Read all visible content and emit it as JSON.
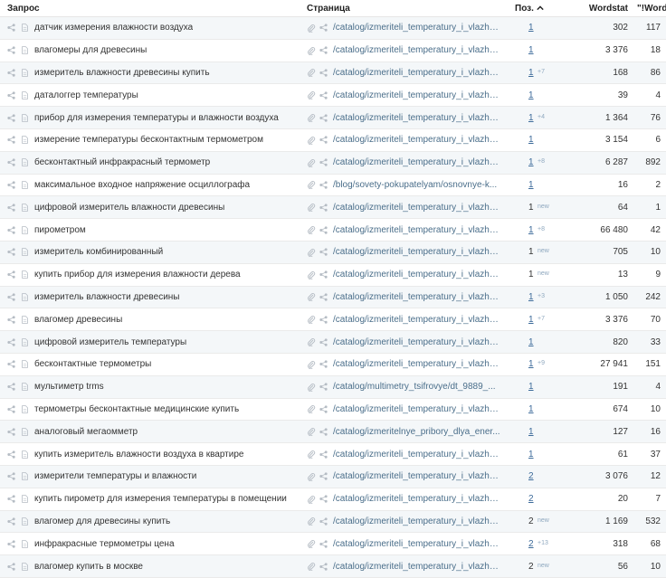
{
  "header": {
    "query": "Запрос",
    "page": "Страница",
    "pos": "Поз.",
    "wordstat": "Wordstat",
    "wordstat_exact": "\"!Wordstat\""
  },
  "rows": [
    {
      "query": "датчик измерения влажности воздуха",
      "url": "/catalog/izmeriteli_temperatury_i_vlazhn...",
      "pos": "1",
      "delta": "",
      "ws": "302",
      "wse": "117",
      "linked": true
    },
    {
      "query": "влагомеры для древесины",
      "url": "/catalog/izmeriteli_temperatury_i_vlazhn...",
      "pos": "1",
      "delta": "",
      "ws": "3 376",
      "wse": "18",
      "linked": true
    },
    {
      "query": "измеритель влажности древесины купить",
      "url": "/catalog/izmeriteli_temperatury_i_vlazhn...",
      "pos": "1",
      "delta": "+7",
      "ws": "168",
      "wse": "86",
      "linked": true
    },
    {
      "query": "даталоггер температуры",
      "url": "/catalog/izmeriteli_temperatury_i_vlazhn...",
      "pos": "1",
      "delta": "",
      "ws": "39",
      "wse": "4",
      "linked": true
    },
    {
      "query": "прибор для измерения температуры и влажности воздуха",
      "url": "/catalog/izmeriteli_temperatury_i_vlazhn...",
      "pos": "1",
      "delta": "+4",
      "ws": "1 364",
      "wse": "76",
      "linked": true
    },
    {
      "query": "измерение температуры бесконтактным термометром",
      "url": "/catalog/izmeriteli_temperatury_i_vlazhn...",
      "pos": "1",
      "delta": "",
      "ws": "3 154",
      "wse": "6",
      "linked": true
    },
    {
      "query": "бесконтактный инфракрасный термометр",
      "url": "/catalog/izmeriteli_temperatury_i_vlazhn...",
      "pos": "1",
      "delta": "+8",
      "ws": "6 287",
      "wse": "892",
      "linked": true
    },
    {
      "query": "максимальное входное напряжение осциллографа",
      "url": "/blog/sovety-pokupatelyam/osnovnye-k...",
      "pos": "1",
      "delta": "",
      "ws": "16",
      "wse": "2",
      "linked": true
    },
    {
      "query": "цифровой измеритель влажности древесины",
      "url": "/catalog/izmeriteli_temperatury_i_vlazhn...",
      "pos": "1",
      "delta": "new",
      "ws": "64",
      "wse": "1",
      "linked": false
    },
    {
      "query": "пирометром",
      "url": "/catalog/izmeriteli_temperatury_i_vlazhn...",
      "pos": "1",
      "delta": "+8",
      "ws": "66 480",
      "wse": "42",
      "linked": true
    },
    {
      "query": "измеритель комбинированный",
      "url": "/catalog/izmeriteli_temperatury_i_vlazhn...",
      "pos": "1",
      "delta": "new",
      "ws": "705",
      "wse": "10",
      "linked": false
    },
    {
      "query": "купить прибор для измерения влажности дерева",
      "url": "/catalog/izmeriteli_temperatury_i_vlazhn...",
      "pos": "1",
      "delta": "new",
      "ws": "13",
      "wse": "9",
      "linked": false
    },
    {
      "query": "измеритель влажности древесины",
      "url": "/catalog/izmeriteli_temperatury_i_vlazhn...",
      "pos": "1",
      "delta": "+3",
      "ws": "1 050",
      "wse": "242",
      "linked": true
    },
    {
      "query": "влагомер древесины",
      "url": "/catalog/izmeriteli_temperatury_i_vlazhn...",
      "pos": "1",
      "delta": "+7",
      "ws": "3 376",
      "wse": "70",
      "linked": true
    },
    {
      "query": "цифровой измеритель температуры",
      "url": "/catalog/izmeriteli_temperatury_i_vlazhn...",
      "pos": "1",
      "delta": "",
      "ws": "820",
      "wse": "33",
      "linked": true
    },
    {
      "query": "бесконтактные термометры",
      "url": "/catalog/izmeriteli_temperatury_i_vlazhn...",
      "pos": "1",
      "delta": "+9",
      "ws": "27 941",
      "wse": "151",
      "linked": true
    },
    {
      "query": "мультиметр trms",
      "url": "/catalog/multimetry_tsifrovye/dt_9889_...",
      "pos": "1",
      "delta": "",
      "ws": "191",
      "wse": "4",
      "linked": true
    },
    {
      "query": "термометры бесконтактные медицинские купить",
      "url": "/catalog/izmeriteli_temperatury_i_vlazhn...",
      "pos": "1",
      "delta": "",
      "ws": "674",
      "wse": "10",
      "linked": true
    },
    {
      "query": "аналоговый мегаомметр",
      "url": "/catalog/izmeritelnye_pribory_dlya_ener...",
      "pos": "1",
      "delta": "",
      "ws": "127",
      "wse": "16",
      "linked": true
    },
    {
      "query": "купить измеритель влажности воздуха в квартире",
      "url": "/catalog/izmeriteli_temperatury_i_vlazhn...",
      "pos": "1",
      "delta": "",
      "ws": "61",
      "wse": "37",
      "linked": true
    },
    {
      "query": "измерители температуры и влажности",
      "url": "/catalog/izmeriteli_temperatury_i_vlazhn...",
      "pos": "2",
      "delta": "",
      "ws": "3 076",
      "wse": "12",
      "linked": true
    },
    {
      "query": "купить пирометр для измерения температуры в помещении",
      "url": "/catalog/izmeriteli_temperatury_i_vlazhn...",
      "pos": "2",
      "delta": "",
      "ws": "20",
      "wse": "7",
      "linked": true
    },
    {
      "query": "влагомер для древесины купить",
      "url": "/catalog/izmeriteli_temperatury_i_vlazhn...",
      "pos": "2",
      "delta": "new",
      "ws": "1 169",
      "wse": "532",
      "linked": false
    },
    {
      "query": "инфракрасные термометры цена",
      "url": "/catalog/izmeriteli_temperatury_i_vlazhn...",
      "pos": "2",
      "delta": "+13",
      "ws": "318",
      "wse": "68",
      "linked": true
    },
    {
      "query": "влагомер купить в москве",
      "url": "/catalog/izmeriteli_temperatury_i_vlazhn...",
      "pos": "2",
      "delta": "new",
      "ws": "56",
      "wse": "10",
      "linked": false
    }
  ],
  "colors": {
    "link": "#3d6b9a",
    "url": "#4a6e8a",
    "delta": "#8fa8bf",
    "icon": "#b5bcc4",
    "stripe": "#f4f7f9"
  },
  "icons": {
    "share": "share-icon",
    "doc": "document-icon",
    "clip": "paperclip-icon",
    "sort": "sort-up-icon"
  }
}
